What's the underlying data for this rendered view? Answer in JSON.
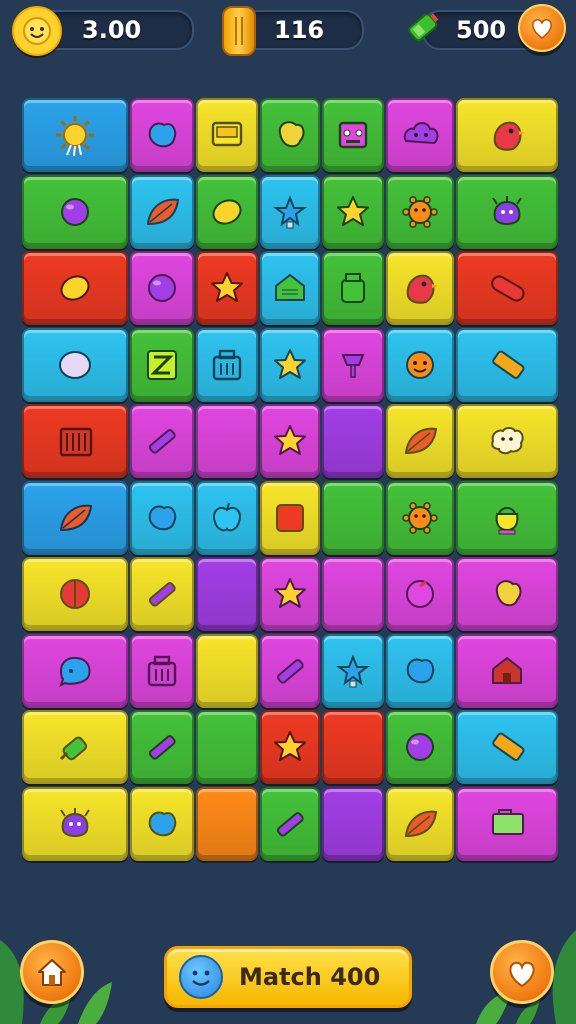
{
  "hud": {
    "score_value": "3.00",
    "coins_value": "116",
    "energy_value": "500",
    "score_icon": "smiley-sun-icon",
    "coins_icon": "gold-bar-icon",
    "energy_icon": "green-battery-icon",
    "heart_icon": "heart-icon"
  },
  "board": {
    "rows": 10,
    "tiles": [
      {
        "c": "#2ba3ec",
        "span": 2,
        "icon": "sun-icon"
      },
      {
        "c": "#e046e0",
        "span": 1,
        "icon": "blob-icon"
      },
      {
        "c": "#f7e52a",
        "span": 1,
        "icon": "screen-icon"
      },
      {
        "c": "#44c23a",
        "span": 1,
        "icon": "blob-icon"
      },
      {
        "c": "#44c23a",
        "span": 1,
        "icon": "robot-icon"
      },
      {
        "c": "#e046e0",
        "span": 1,
        "icon": "cloud-icon"
      },
      {
        "c": "#f7e52a",
        "span": 2,
        "icon": "bird-icon"
      }
    ]
  },
  "colors": {
    "blue": "#2ba3ec",
    "magenta": "#e046e0",
    "yellow": "#f7e52a",
    "green": "#44c23a",
    "red": "#ee3a22",
    "purple": "#a23ee6",
    "cyan": "#2ec3f0",
    "orange": "#ff8a18",
    "background": "#253a55"
  },
  "footer": {
    "match_label": "Match 400",
    "home_icon": "home-icon",
    "hint_icon": "hint-icon"
  }
}
